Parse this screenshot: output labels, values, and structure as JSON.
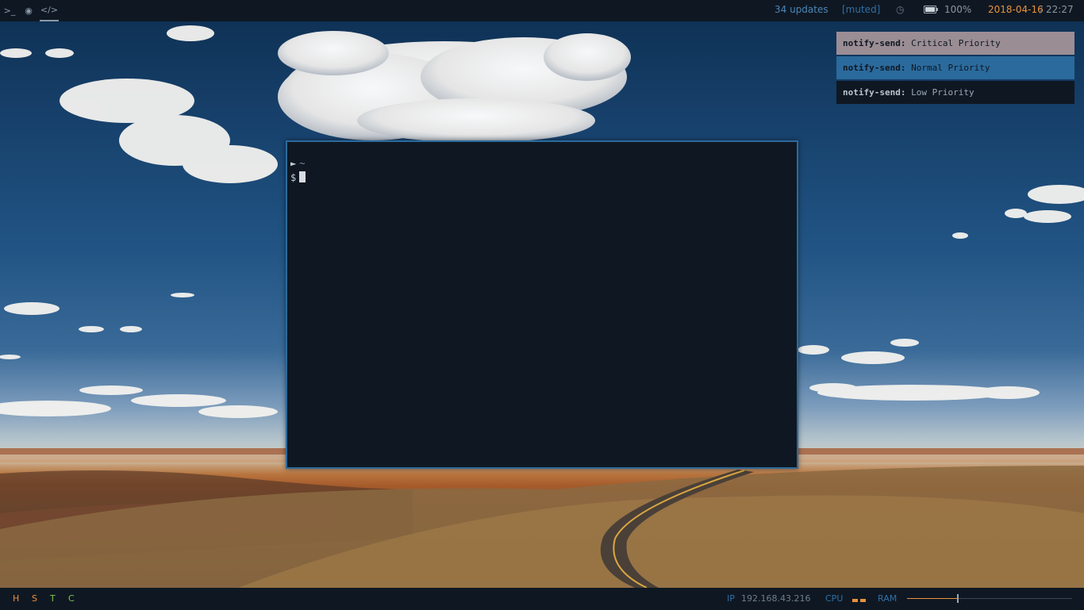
{
  "topbar": {
    "workspaces": [
      {
        "icon": "terminal-icon",
        "glyph": ">_"
      },
      {
        "icon": "chrome-icon",
        "glyph": "◉"
      },
      {
        "icon": "code-icon",
        "glyph": "</>"
      }
    ],
    "updates": "34 updates",
    "volume": "[muted]",
    "clock_glyph": "◷",
    "battery": "100%",
    "date": "2018-04-16",
    "date_sep": "/",
    "time": "22:27"
  },
  "notifications": [
    {
      "app": "notify-send:",
      "text": "Critical Priority"
    },
    {
      "app": "notify-send:",
      "text": "Normal Priority"
    },
    {
      "app": "notify-send:",
      "text": "Low Priority"
    }
  ],
  "terminal": {
    "prompt_arrow": "►",
    "cwd": "~",
    "prompt": "$"
  },
  "bottombar": {
    "workspaces": [
      "H",
      "S",
      "T",
      "C"
    ],
    "ip_label": "IP",
    "ip": "192.168.43.216",
    "cpu_label": "CPU",
    "ram_label": "RAM",
    "ram_fraction": 0.31
  },
  "colors": {
    "accent_orange": "#e8913e",
    "accent_blue": "#2f6fa8",
    "accent_green": "#7ac74f",
    "bar_bg": "#0f1822"
  }
}
